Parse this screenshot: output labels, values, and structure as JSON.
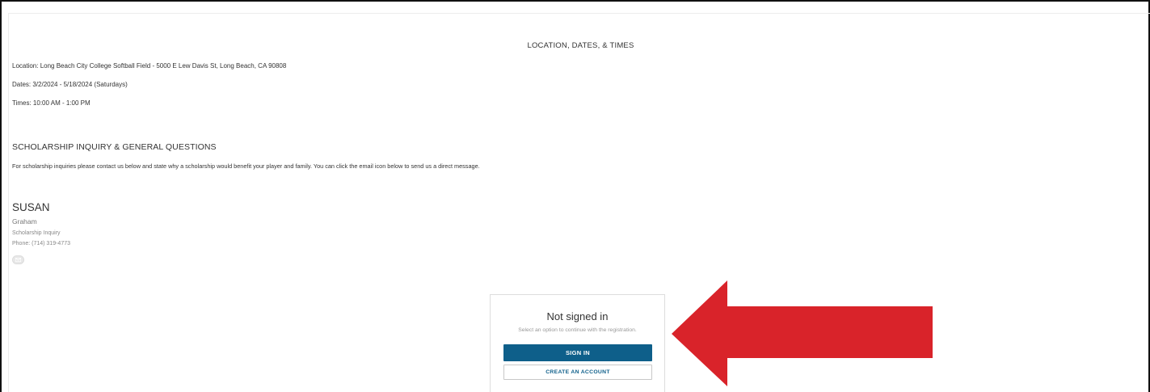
{
  "location_section": {
    "title": "LOCATION, DATES, & TIMES",
    "location": "Location: Long Beach City College Softball Field - 5000 E Lew Davis St, Long Beach, CA 90808",
    "dates": "Dates: 3/2/2024 - 5/18/2024 (Saturdays)",
    "times": "Times: 10:00 AM - 1:00 PM"
  },
  "scholarship_section": {
    "title": "SCHOLARSHIP INQUIRY & GENERAL QUESTIONS",
    "text": "For scholarship inquiries please contact us below and state why a scholarship would benefit your player and family. You can click the email icon below to send us a direct message."
  },
  "contact": {
    "first_name": "SUSAN",
    "last_name": "Graham",
    "role": "Scholarship Inquiry",
    "phone": "Phone: (714) 319-4773",
    "email_icon": "envelope-icon"
  },
  "signin_card": {
    "heading": "Not signed in",
    "subtext": "Select an option to continue with the registration.",
    "signin_label": "SIGN IN",
    "create_account_label": "CREATE AN ACCOUNT"
  },
  "colors": {
    "accent": "#0e5f8a",
    "arrow": "#d9232a"
  }
}
